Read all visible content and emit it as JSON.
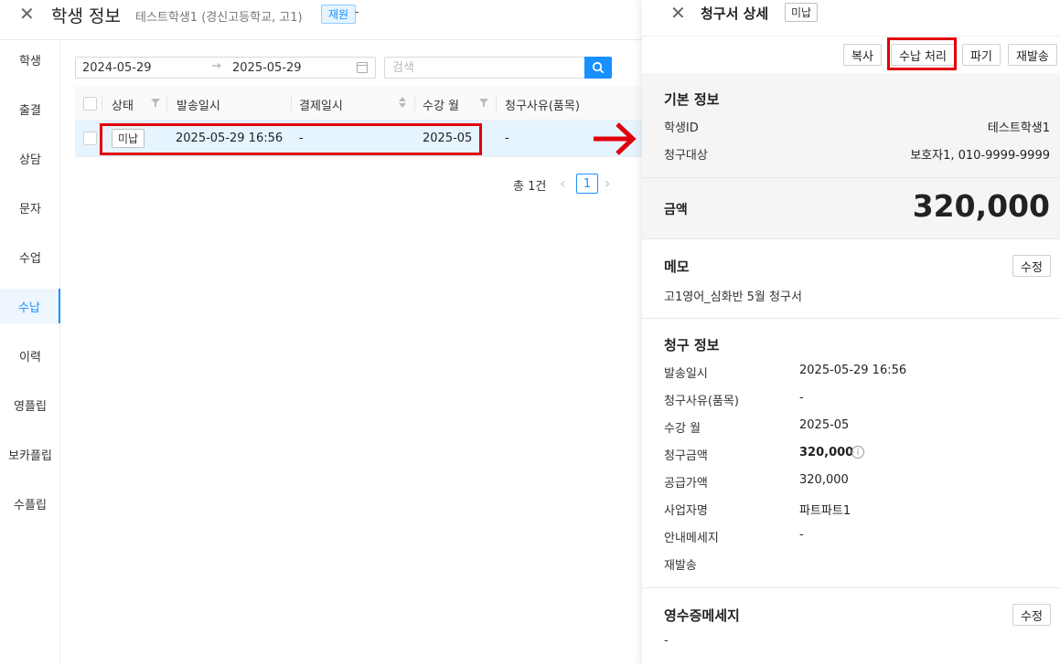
{
  "header": {
    "title": "학생 정보",
    "subtitle": "테스트학생1 (경신고등학교, 고1)",
    "badge": "재원",
    "trailing": "-"
  },
  "sidebar": {
    "items": [
      {
        "label": "학생"
      },
      {
        "label": "출결"
      },
      {
        "label": "상담"
      },
      {
        "label": "문자"
      },
      {
        "label": "수업"
      },
      {
        "label": "수납"
      },
      {
        "label": "이력"
      },
      {
        "label": "영플립"
      },
      {
        "label": "보카플립"
      },
      {
        "label": "수플립"
      }
    ],
    "active_index": 5
  },
  "filters": {
    "date_start": "2024-05-29",
    "date_sep": "→",
    "date_end": "2025-05-29",
    "search_placeholder": "검색"
  },
  "table": {
    "columns": [
      "상태",
      "발송일시",
      "결제일시",
      "수강 월",
      "청구사유(품목)"
    ],
    "rows": [
      {
        "status": "미납",
        "sent_at": "2025-05-29 16:56",
        "paid_at": "-",
        "month": "2025-05",
        "reason": "-"
      }
    ]
  },
  "pagination": {
    "total": "총 1건",
    "current": "1"
  },
  "drawer": {
    "title": "청구서 상세",
    "status": "미납",
    "buttons": {
      "copy": "복사",
      "pay": "수납 처리",
      "discard": "파기",
      "resend": "재발송"
    },
    "basic": {
      "title": "기본 정보",
      "student_id_label": "학생ID",
      "student_id": "테스트학생1",
      "target_label": "청구대상",
      "target": "보호자1, 010-9999-9999"
    },
    "amount": {
      "label": "금액",
      "value": "320,000"
    },
    "memo": {
      "title": "메모",
      "edit": "수정",
      "text": "고1영어_심화반 5월 청구서"
    },
    "billing": {
      "title": "청구 정보",
      "items": [
        {
          "label": "발송일시",
          "value": "2025-05-29 16:56"
        },
        {
          "label": "청구사유(품목)",
          "value": "-"
        },
        {
          "label": "수강 월",
          "value": "2025-05"
        },
        {
          "label": "청구금액",
          "value": "320,000"
        },
        {
          "label": "공급가액",
          "value": "320,000"
        },
        {
          "label": "사업자명",
          "value": "파트파트1"
        },
        {
          "label": "안내메세지",
          "value": "-"
        },
        {
          "label": "재발송",
          "value": ""
        }
      ]
    },
    "receipt": {
      "title": "영수증메세지",
      "edit": "수정",
      "text": "-"
    }
  },
  "colors": {
    "accent": "#1890ff",
    "highlight": "#e0000b",
    "row_selected": "#e6f4ff"
  }
}
